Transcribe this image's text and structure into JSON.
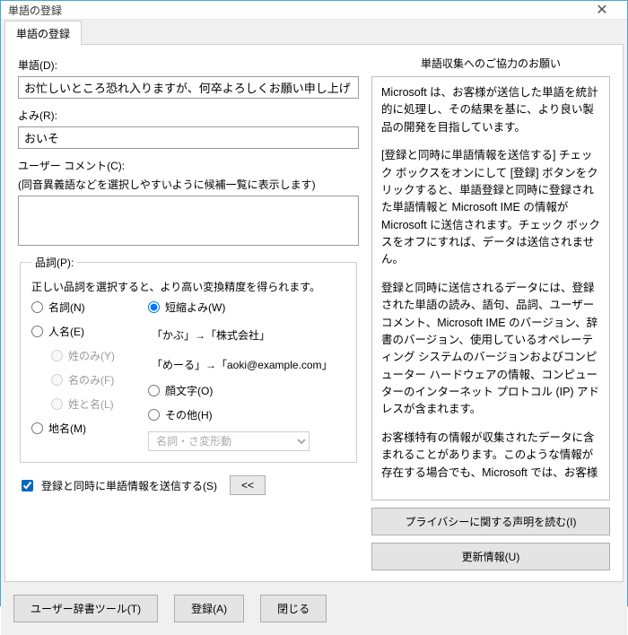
{
  "window": {
    "title": "単語の登録"
  },
  "tab": {
    "label": "単語の登録"
  },
  "fields": {
    "word_label": "単語(D):",
    "word_value": "お忙しいところ恐れ入りますが、何卒よろしくお願い申し上げます。",
    "yomi_label": "よみ(R):",
    "yomi_value": "おいそ",
    "comment_label": "ユーザー コメント(C):",
    "comment_hint": "(同音異義語などを選択しやすいように候補一覧に表示します)"
  },
  "pos": {
    "legend": "品詞(P):",
    "note": "正しい品詞を選択すると、より高い変換精度を得られます。",
    "r_noun": "名詞(N)",
    "r_person": "人名(E)",
    "r_last": "姓のみ(Y)",
    "r_first": "名のみ(F)",
    "r_full": "姓と名(L)",
    "r_place": "地名(M)",
    "r_abbrev": "短縮よみ(W)",
    "eg1": "「かぶ」→「株式会社」",
    "eg2": "「めーる」→「aoki@example.com」",
    "r_kao": "顔文字(O)",
    "r_other": "その他(H)",
    "select_ph": "名詞・さ変形動"
  },
  "send": {
    "checkbox": "登録と同時に単語情報を送信する(S)",
    "toggle": "<<"
  },
  "right": {
    "title": "単語収集へのご協力のお願い",
    "p1": "Microsoft は、お客様が送信した単語を統計的に処理し、その結果を基に、より良い製品の開発を目指しています。",
    "p2": "[登録と同時に単語情報を送信する] チェック ボックスをオンにして [登録] ボタンをクリックすると、単語登録と同時に登録された単語情報と Microsoft IME の情報が Microsoft に送信されます。チェック ボックスをオフにすれば、データは送信されません。",
    "p3": "登録と同時に送信されるデータには、登録された単語の読み、語句、品詞、ユーザー コメント、Microsoft IME のバージョン、辞書のバージョン、使用しているオペレーティング システムのバージョンおよびコンピューター ハードウェアの情報、コンピューターのインターネット プロトコル (IP) アドレスが含まれます。",
    "p4": "お客様特有の情報が収集されたデータに含まれることがあります。このような情報が存在する場合でも、Microsoft では、お客様",
    "privacy_btn": "プライバシーに関する声明を読む(I)",
    "update_btn": "更新情報(U)"
  },
  "footer": {
    "dict_tool": "ユーザー辞書ツール(T)",
    "register": "登録(A)",
    "close": "閉じる"
  }
}
